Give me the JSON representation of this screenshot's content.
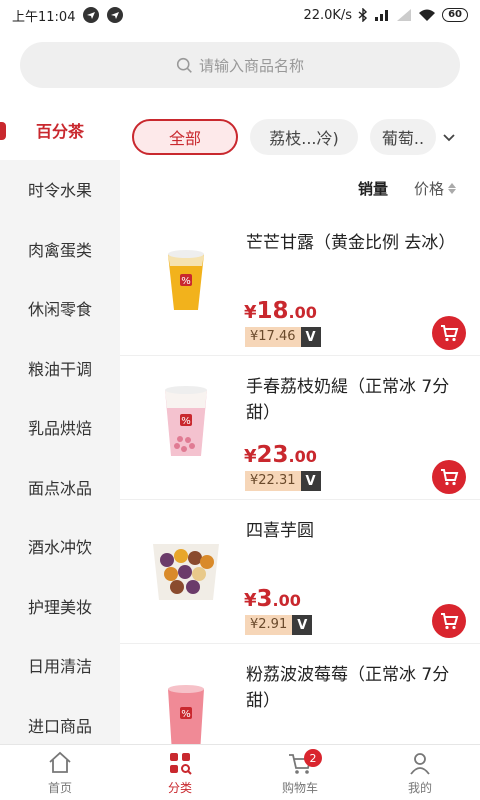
{
  "status_bar": {
    "time": "上午11:04",
    "network_speed": "22.0K/s",
    "battery": "60"
  },
  "search": {
    "placeholder": "请输入商品名称"
  },
  "sidebar": {
    "items": [
      {
        "label": "百分茶",
        "active": true
      },
      {
        "label": "时令水果"
      },
      {
        "label": "肉禽蛋类"
      },
      {
        "label": "休闲零食"
      },
      {
        "label": "粮油干调"
      },
      {
        "label": "乳品烘焙"
      },
      {
        "label": "面点冰品"
      },
      {
        "label": "酒水冲饮"
      },
      {
        "label": "护理美妆"
      },
      {
        "label": "日用清洁"
      },
      {
        "label": "进口商品"
      }
    ]
  },
  "tabs": [
    {
      "label": "全部",
      "active": true
    },
    {
      "label": "荔枝...冷)"
    },
    {
      "label": "葡萄.."
    }
  ],
  "sort": {
    "sales_label": "销量",
    "price_label": "价格"
  },
  "products": [
    {
      "name": "芒芒甘露（黄金比例 去冰）",
      "price_int": "18",
      "price_dec": ".00",
      "vip_price": "¥17.46",
      "vip_badge": "V",
      "image": "yellow-drink-cup"
    },
    {
      "name": "手春荔枝奶緹（正常冰 7分甜）",
      "price_int": "23",
      "price_dec": ".00",
      "vip_price": "¥22.31",
      "vip_badge": "V",
      "image": "pink-milk-tea-cup"
    },
    {
      "name": "四喜芋圆",
      "price_int": "3",
      "price_dec": ".00",
      "vip_price": "¥2.91",
      "vip_badge": "V",
      "image": "taro-balls-cup"
    },
    {
      "name": "粉荔波波莓莓（正常冰 7分甜）",
      "price_int": "",
      "price_dec": "",
      "vip_price": "",
      "vip_badge": "",
      "image": "pink-drink-cup"
    }
  ],
  "currency_symbol": "¥",
  "bottom_nav": {
    "home": "首页",
    "category": "分类",
    "cart": "购物车",
    "cart_count": "2",
    "mine": "我的"
  },
  "colors": {
    "accent": "#c9282e",
    "vip_bg": "#f6d6b8"
  }
}
